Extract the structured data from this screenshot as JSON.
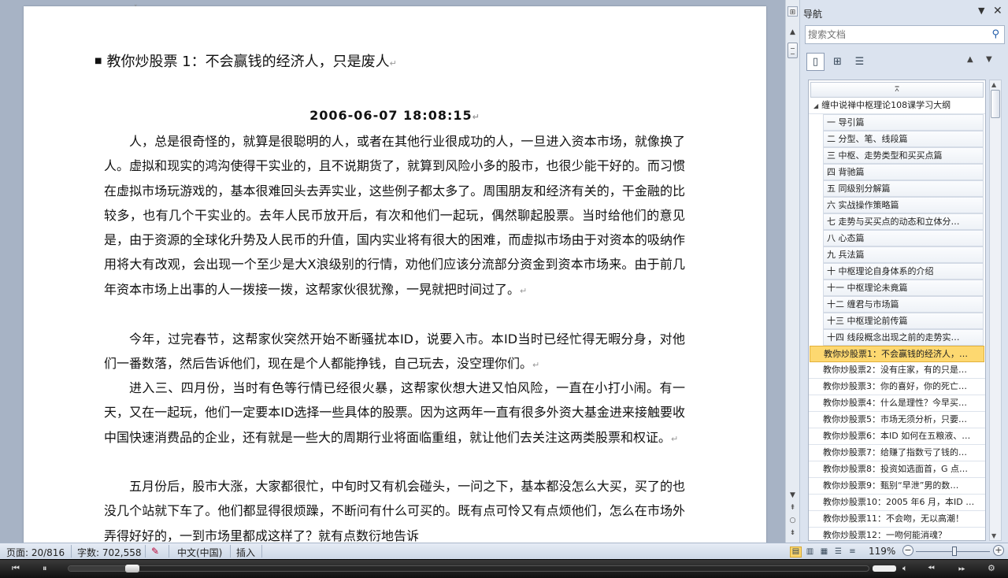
{
  "document": {
    "heading": "教你炒股票 1：不会赢钱的经济人，只是废人",
    "datetime": "2006-06-07  18:08:15",
    "paragraphs": [
      "人，总是很奇怪的，就算是很聪明的人，或者在其他行业很成功的人，一旦进入资本市场，就像换了人。虚拟和现实的鸿沟使得干实业的，且不说期货了，就算到风险小多的股市，也很少能干好的。而习惯在虚拟市场玩游戏的，基本很难回头去弄实业，这些例子都太多了。周围朋友和经济有关的，干金融的比较多，也有几个干实业的。去年人民币放开后，有次和他们一起玩，偶然聊起股票。当时给他们的意见是，由于资源的全球化升势及人民币的升值，国内实业将有很大的困难，而虚拟市场由于对资本的吸纳作用将大有改观，会出现一个至少是大X浪级别的行情，劝他们应该分流部分资金到资本市场来。由于前几年资本市场上出事的人一拨接一拨，这帮家伙很犹豫，一晃就把时间过了。",
      "今年，过完春节，这帮家伙突然开始不断骚扰本ID，说要入市。本ID当时已经忙得无暇分身，对他们一番数落，然后告诉他们，现在是个人都能挣钱，自己玩去，没空理你们。",
      "进入三、四月份，当时有色等行情已经很火暴，这帮家伙想大进又怕风险，一直在小打小闹。有一天，又在一起玩，他们一定要本ID选择一些具体的股票。因为这两年一直有很多外资大基金进来接触要收中国快速消费品的企业，还有就是一些大的周期行业将面临重组，就让他们去关注这两类股票和权证。",
      "五月份后，股市大涨，大家都很忙，中旬时又有机会碰头，一问之下，基本都没怎么大买，买了的也没几个站就下车了。他们都显得很烦躁，不断问有什么可买的。既有点可怜又有点烦他们，怎么在市场外弄得好好的，一到市场里都成这样了？就有点数衍地告诉"
    ],
    "para_mark": "↵"
  },
  "nav": {
    "title": "导航",
    "search_placeholder": "搜索文档",
    "root": "缠中说禅中枢理论108课学习大纲",
    "chapters": [
      "一 导引篇",
      "二 分型、笔、线段篇",
      "三 中枢、走势类型和买买点篇",
      "四 背驰篇",
      "五 同级别分解篇",
      "六 实战操作策略篇",
      "七 走势与买买点的动态和立体分…",
      "八 心态篇",
      "九 兵法篇",
      "十 中枢理论自身体系的介绍",
      "十一 中枢理论未竟篇",
      "十二 缠君与市场篇",
      "十三 中枢理论前传篇",
      "十四 线段概念出现之前的走势实…"
    ],
    "lessons": [
      "教你炒股票1：不会赢钱的经济人，…",
      "教你炒股票2：没有庄家，有的只是…",
      "教你炒股票3：你的喜好，你的死亡…",
      "教你炒股票4：什么是理性？今早买…",
      "教你炒股票5：市场无须分析，只要…",
      "教你炒股票6：本ID 如何在五粮液、…",
      "教你炒股票7：给赚了指数亏了钱的…",
      "教你炒股票8：投资如选面首，G 点…",
      "教你炒股票9：甄别“早泄”男的数…",
      "教你炒股票10：2005 年6 月，本ID …",
      "教你炒股票11：不会吻，无以高潮！",
      "教你炒股票12：一吻何能消魂？"
    ],
    "selected_index": 0
  },
  "status": {
    "page": "页面: 20/816",
    "words": "字数: 702,558",
    "language": "中文(中国)",
    "mode": "插入",
    "zoom": "119%"
  },
  "player": {
    "progress": 0.08
  },
  "colors": {
    "selected_item": "#fdd870",
    "workspace": "#a7b3c5"
  }
}
